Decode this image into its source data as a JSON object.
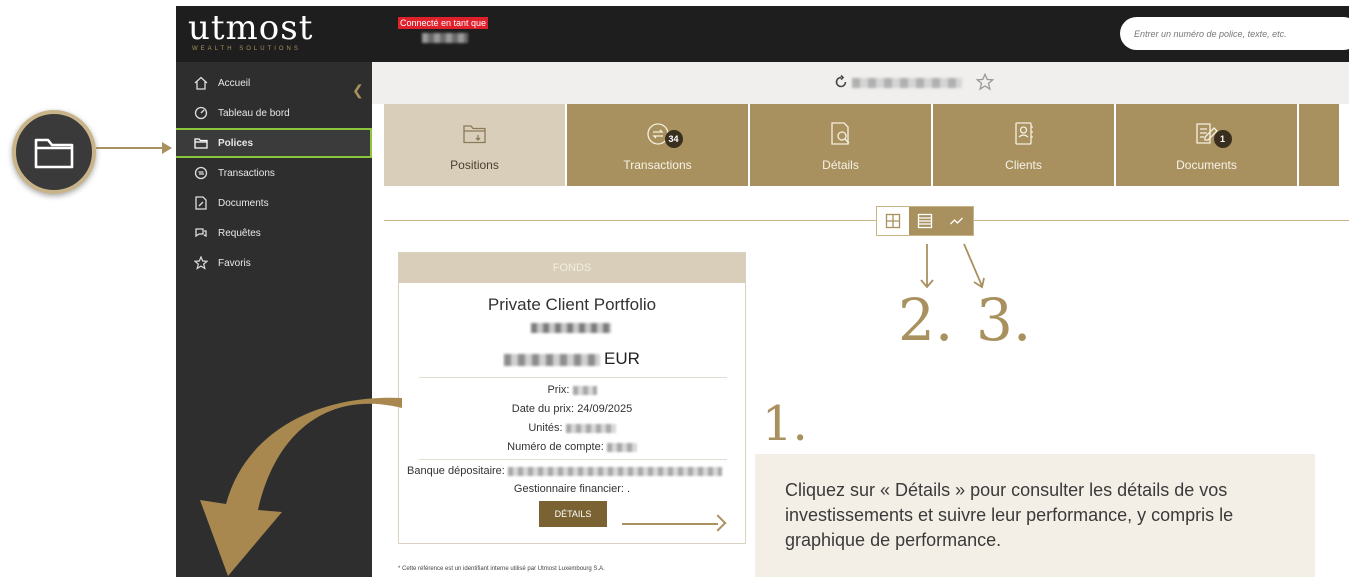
{
  "app": {
    "logo": "utmost",
    "logo_sub": "WEALTH SOLUTIONS",
    "login_label": "Connecté en tant que",
    "search_placeholder": "Entrer un numéro de police, texte, etc."
  },
  "sidebar": {
    "items": [
      {
        "label": "Accueil",
        "icon": "home-icon"
      },
      {
        "label": "Tableau de bord",
        "icon": "dashboard-icon"
      },
      {
        "label": "Polices",
        "icon": "folder-icon",
        "active": true
      },
      {
        "label": "Transactions",
        "icon": "transactions-icon"
      },
      {
        "label": "Documents",
        "icon": "document-icon"
      },
      {
        "label": "Requêtes",
        "icon": "requests-icon"
      },
      {
        "label": "Favoris",
        "icon": "star-icon"
      }
    ]
  },
  "tabs": [
    {
      "label": "Positions",
      "icon": "folder-arrow-icon",
      "active": true
    },
    {
      "label": "Transactions",
      "icon": "transactions-icon",
      "count": "34"
    },
    {
      "label": "Détails",
      "icon": "details-icon"
    },
    {
      "label": "Clients",
      "icon": "clients-icon"
    },
    {
      "label": "Documents",
      "icon": "document-edit-icon",
      "count": "1"
    }
  ],
  "fund_card": {
    "header": "FONDS",
    "name": "Private Client Portfolio",
    "currency": "EUR",
    "price_label": "Prix:",
    "price_date_label": "Date du prix:",
    "price_date": "24/09/2025",
    "units_label": "Unités:",
    "account_label": "Numéro de compte:",
    "bank_label": "Banque dépositaire:",
    "manager_label": "Gestionnaire financier:",
    "manager_value": ".",
    "details_button": "DÉTAILS",
    "footnote": "* Cette référence est un identifiant interne utilisé par Utmost Luxembourg S.A."
  },
  "annotations": {
    "step1": "1.",
    "step2": "2.",
    "step3": "3.",
    "panel_text": "Cliquez sur « Détails » pour consulter les détails de vos investissements et suivre leur performance, y compris le graphique de performance."
  },
  "colors": {
    "gold": "#a8915e",
    "gold_light": "#d9ceb9",
    "dark": "#1e1e1e",
    "sidebar": "#2e2e2e",
    "highlight": "#8cc63f"
  }
}
